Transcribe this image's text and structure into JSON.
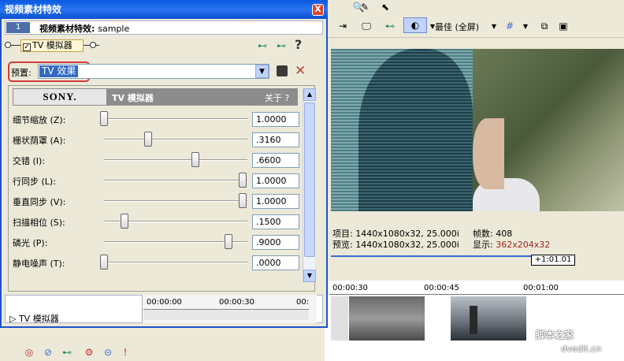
{
  "dialog": {
    "title": "视频素材特效",
    "close_glyph": "X",
    "header_number": "1",
    "header_label": "视频素材特效: ",
    "header_clip": "sample"
  },
  "chain": {
    "effect_label": "TV 模拟器",
    "help_glyph": "?"
  },
  "preset": {
    "label": "预置:",
    "value": "TV 效果"
  },
  "plugin": {
    "vendor": "SONY.",
    "name": "TV 模拟器",
    "about": "关于 ?"
  },
  "params": [
    {
      "label": "细节缩放 (Z):",
      "value": "1.0000",
      "level": 0.0
    },
    {
      "label": "栅状荫罩 (A):",
      "value": ".3160",
      "level": 0.316
    },
    {
      "label": "交错 (I):",
      "value": ".6600",
      "level": 0.66
    },
    {
      "label": "行同步 (L):",
      "value": "1.0000",
      "level": 1.0
    },
    {
      "label": "垂直同步 (V):",
      "value": "1.0000",
      "level": 1.0
    },
    {
      "label": "扫描相位 (S):",
      "value": ".1500",
      "level": 0.15
    },
    {
      "label": "磷光 (P):",
      "value": ".9000",
      "level": 0.9
    },
    {
      "label": "静电噪声 (T):",
      "value": ".0000",
      "level": 0.0
    }
  ],
  "footer": {
    "label": "▷ TV 模拟器",
    "t0": "00:00:00",
    "t1": "00:00:30",
    "t2": "00:"
  },
  "preview": {
    "quality": "最佳 (全屏)",
    "project_label": "项目:",
    "project_value": "1440x1080x32, 25.000i",
    "frames_label": "帧数:",
    "frames_value": "408",
    "preview_label": "预览:",
    "preview_value": "1440x1080x32, 25.000i",
    "display_label": "显示:",
    "display_value": "362x204x32"
  },
  "timeline": {
    "cursor_time": "+1:01.01",
    "mark1": "00:00:30",
    "mark2": "00:00:45",
    "mark3": "00:01:00"
  },
  "watermark": {
    "line1": "脚本之家",
    "line2": "dvedit.cn"
  }
}
